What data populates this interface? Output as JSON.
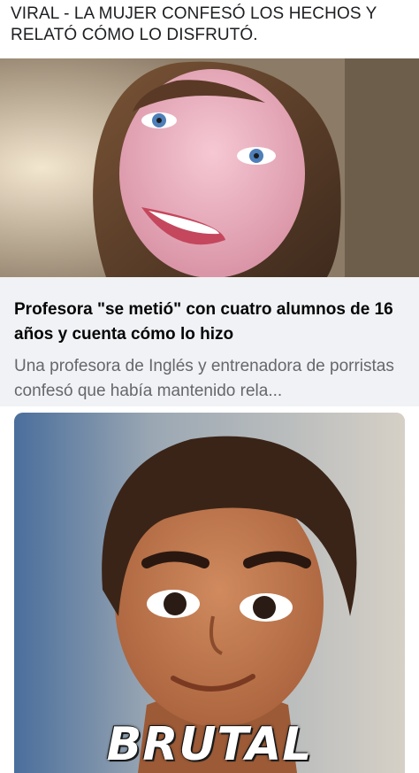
{
  "post": {
    "text": "VIRAL - LA MUJER CONFESÓ LOS HECHOS Y RELATÓ CÓMO LO DISFRUTÓ."
  },
  "link_preview": {
    "title": "Profesora \"se metió\" con cuatro alumnos de 16 años y cuenta cómo lo hizo",
    "description": "Una profesora de Inglés y entrenadora de porristas confesó que había mantenido rela..."
  },
  "meme": {
    "caption": "BRUTAL"
  }
}
